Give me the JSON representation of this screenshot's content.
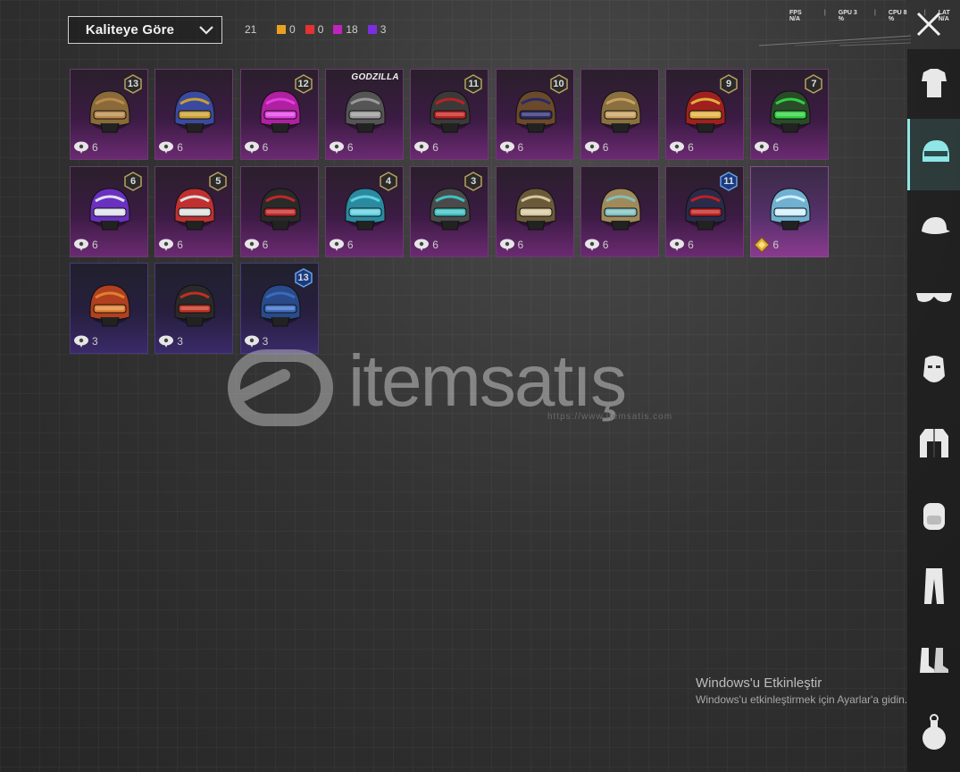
{
  "topbar": {
    "sort_label": "Kaliteye Göre",
    "total_count": "21",
    "rarity_counts": [
      {
        "color": "#e8a21e",
        "value": "0"
      },
      {
        "color": "#e33232",
        "value": "0"
      },
      {
        "color": "#c024c0",
        "value": "18"
      },
      {
        "color": "#7a2ee0",
        "value": "3"
      }
    ],
    "stats": {
      "fps_label": "FPS",
      "fps_value": "N/A",
      "gpu_label": "GPU",
      "gpu_value": "3 %",
      "cpu_label": "CPU",
      "cpu_value": "8 %",
      "lat_label": "LAT",
      "lat_value": "N/A"
    }
  },
  "items": [
    {
      "badge": "13",
      "cost": "6",
      "rarity": "epic",
      "colors": [
        "#8a6a3a",
        "#b98a4a"
      ],
      "currency": "gift"
    },
    {
      "badge": "",
      "cost": "6",
      "rarity": "epic",
      "colors": [
        "#3a4aa0",
        "#c8a030"
      ],
      "currency": "gift"
    },
    {
      "badge": "12",
      "cost": "6",
      "rarity": "epic",
      "colors": [
        "#b020a0",
        "#e040e0"
      ],
      "currency": "gift"
    },
    {
      "badge": "",
      "tag": "GODZILLA",
      "cost": "6",
      "rarity": "epic",
      "colors": [
        "#555",
        "#999"
      ],
      "currency": "gift"
    },
    {
      "badge": "11",
      "cost": "6",
      "rarity": "epic",
      "colors": [
        "#3a3a3a",
        "#c02020"
      ],
      "currency": "gift"
    },
    {
      "badge": "10",
      "cost": "6",
      "rarity": "epic",
      "colors": [
        "#6a4a2a",
        "#2a2a6a"
      ],
      "currency": "gift"
    },
    {
      "badge": "",
      "cost": "6",
      "rarity": "epic",
      "colors": [
        "#8a7040",
        "#c8a060"
      ],
      "currency": "gift"
    },
    {
      "badge": "9",
      "cost": "6",
      "rarity": "epic",
      "colors": [
        "#a02020",
        "#e0b040"
      ],
      "currency": "gift"
    },
    {
      "badge": "7",
      "cost": "6",
      "rarity": "epic",
      "colors": [
        "#2a4a2a",
        "#30d040"
      ],
      "currency": "gift"
    },
    {
      "badge": "6",
      "cost": "6",
      "rarity": "epic",
      "colors": [
        "#6a30c0",
        "#e0e0f0"
      ],
      "currency": "gift"
    },
    {
      "badge": "5",
      "cost": "6",
      "rarity": "epic",
      "colors": [
        "#c03030",
        "#e0e0e0"
      ],
      "currency": "gift"
    },
    {
      "badge": "",
      "cost": "6",
      "rarity": "epic",
      "colors": [
        "#2a2a2a",
        "#c02828"
      ],
      "currency": "gift"
    },
    {
      "badge": "4",
      "cost": "6",
      "rarity": "epic",
      "colors": [
        "#2a8aa0",
        "#60d0e0"
      ],
      "currency": "gift"
    },
    {
      "badge": "3",
      "cost": "6",
      "rarity": "epic",
      "colors": [
        "#4a4a4a",
        "#40c0c0"
      ],
      "currency": "gift"
    },
    {
      "badge": "",
      "cost": "6",
      "rarity": "epic",
      "colors": [
        "#6a5a3a",
        "#d8c8a0"
      ],
      "currency": "gift"
    },
    {
      "badge": "",
      "cost": "6",
      "rarity": "epic",
      "colors": [
        "#a08a5a",
        "#80c0c0"
      ],
      "currency": "gift"
    },
    {
      "badge": "11",
      "badge_style": "blue",
      "cost": "6",
      "rarity": "epic",
      "colors": [
        "#2a2a4a",
        "#c02020"
      ],
      "currency": "gift"
    },
    {
      "badge": "",
      "cost": "6",
      "rarity": "legend",
      "colors": [
        "#70b0d0",
        "#d0f0ff"
      ],
      "currency": "diamond"
    },
    {
      "badge": "",
      "cost": "3",
      "rarity": "blue",
      "colors": [
        "#b04020",
        "#e08030"
      ],
      "currency": "gift"
    },
    {
      "badge": "",
      "cost": "3",
      "rarity": "blue",
      "colors": [
        "#2a2a2a",
        "#c03020"
      ],
      "currency": "gift"
    },
    {
      "badge": "13",
      "badge_style": "blue",
      "cost": "3",
      "rarity": "blue",
      "colors": [
        "#2a4a8a",
        "#3a6ac0"
      ],
      "currency": "gift"
    }
  ],
  "watermark": {
    "brand": "itemsatış",
    "url": "https://www.itemsatis.com"
  },
  "windows": {
    "title": "Windows'u Etkinleştir",
    "subtitle": "Windows'u etkinleştirmek için Ayarlar'a gidin."
  },
  "sidebar": [
    {
      "name": "outfit",
      "active": false
    },
    {
      "name": "helmet",
      "active": true
    },
    {
      "name": "hat",
      "active": false
    },
    {
      "name": "glasses",
      "active": false
    },
    {
      "name": "mask",
      "active": false
    },
    {
      "name": "jacket",
      "active": false
    },
    {
      "name": "backpack",
      "active": false
    },
    {
      "name": "pants",
      "active": false
    },
    {
      "name": "shoes",
      "active": false
    },
    {
      "name": "grenade",
      "active": false
    }
  ]
}
